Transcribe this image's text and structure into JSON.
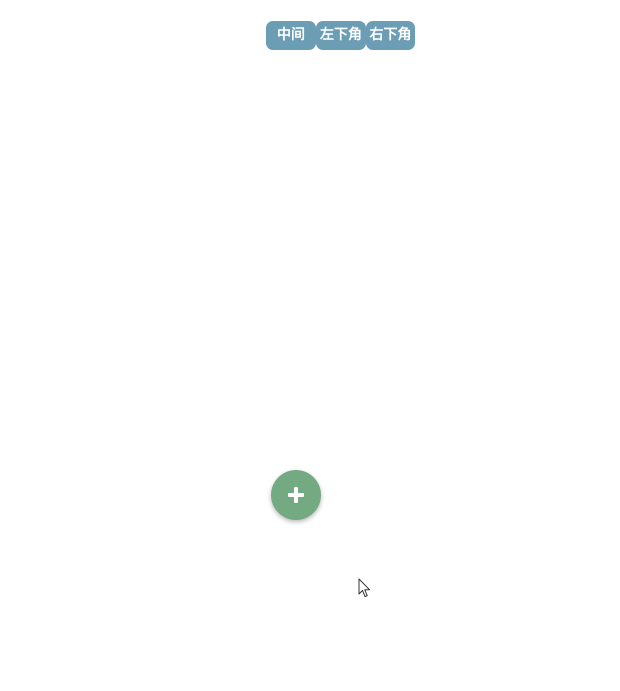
{
  "toolbar": {
    "buttons": [
      {
        "label": "中间",
        "icon": null
      },
      {
        "label": "左下角",
        "icon": null
      },
      {
        "label": "右下角",
        "icon": null
      }
    ],
    "button_color": "#6b9eb5"
  },
  "fab": {
    "icon": "plus-icon",
    "color": "#74aa82"
  },
  "cursor": {
    "icon": "mouse-pointer-icon"
  }
}
